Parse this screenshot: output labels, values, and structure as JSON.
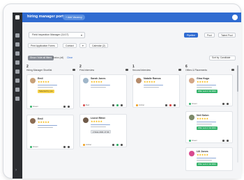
{
  "app": {
    "title": "hiring manager portal",
    "top_button": "+ Add Vacancy"
  },
  "toolbar": {
    "vacancy_select": "Field Inspection Manager (11/17)",
    "views": [
      "Pipeline",
      "Pool",
      "Talent Pool"
    ],
    "actions": [
      "Print Application Forms",
      "Contact",
      "Calendar (2)"
    ]
  },
  "filters": {
    "chip": "Show / hide all filters",
    "status": "Status (all)",
    "reset": "Clear",
    "sort": "Sort by: Candidate"
  },
  "columns": [
    {
      "count": "2",
      "name": "Hiring Manager Shortlist"
    },
    {
      "count": "2",
      "name": "First Interview"
    },
    {
      "count": "1",
      "name": "Second Interview"
    },
    {
      "count": "6",
      "name": "Offers & Placements"
    }
  ],
  "cards": [
    {
      "name": "Emil",
      "stars": "★★★★★",
      "tag": "Selected by you",
      "tag_style": "yellow",
      "foot": "Green",
      "dot_color": "#35b36b"
    },
    {
      "name": "Emil",
      "stars": "★★★★★",
      "tag": "",
      "tag_style": "",
      "foot": "Green",
      "dot_color": "#35b36b"
    },
    {
      "name": "Sarah Jones",
      "stars": "★★★★★",
      "tag": "",
      "tag_style": "",
      "foot": "Red",
      "dot_color": "#d94b4b"
    },
    {
      "name": "Lionel Ritter",
      "stars": "★★★★★",
      "tag": "2 Slots 2021 17:30",
      "tag_style": "grey",
      "foot": "Amber",
      "dot_color": "#f0a020"
    },
    {
      "name": "Natalie Ramos",
      "stars": "★★★★★",
      "tag": "",
      "tag_style": "",
      "foot": "Amber",
      "dot_color": "#f0a020"
    },
    {
      "name": "Gina Hugo",
      "stars": "★★★★★",
      "tag": "Offer sent 2 Jul 2021",
      "tag_style": "green",
      "foot": "Green",
      "dot_color": "#35b36b"
    },
    {
      "name": "Neil Solon",
      "stars": "★★★★★",
      "tag": "Offer sent 2 Jul 2021",
      "tag_style": "green",
      "foot": "Green",
      "dot_color": "#35b36b"
    },
    {
      "name": "Lili Jones",
      "stars": "★★★★★",
      "tag": "Offer sent 2 Jul 2021",
      "tag_style": "green",
      "foot": "",
      "dot_color": ""
    }
  ],
  "colors": {
    "brand": "#2f6bd1",
    "sidebar": "#2b2d31",
    "rating": "#f5b400"
  }
}
